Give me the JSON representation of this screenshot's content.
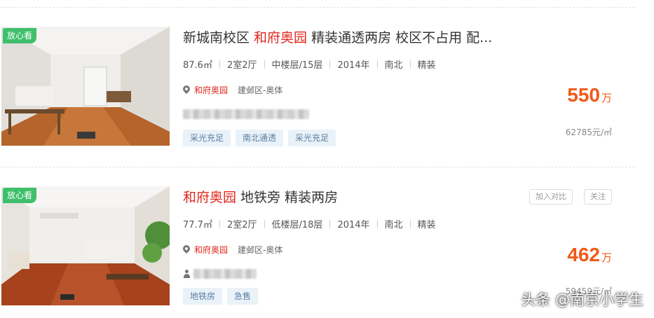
{
  "listings": [
    {
      "badge": "放心看",
      "title_prefix": "新城南校区 ",
      "title_highlight": "和府奥园",
      "title_suffix": " 精装通透两房 校区不占用 配...",
      "facts": {
        "area": "87.6㎡",
        "layout": "2室2厅",
        "floor": "中楼层/15层",
        "year": "2014年",
        "orientation": "南北",
        "decoration": "精装"
      },
      "community": "和府奥园",
      "district": "建邺区-奥体",
      "tags": [
        "采光充足",
        "南北通透",
        "采光充足"
      ],
      "price": "550",
      "price_unit": "万",
      "unit_price": "62785元/㎡"
    },
    {
      "badge": "放心看",
      "title_highlight": "和府奥园",
      "title_suffix": " 地铁旁 精装两房",
      "facts": {
        "area": "77.7㎡",
        "layout": "2室2厅",
        "floor": "低楼层/18层",
        "year": "2014年",
        "orientation": "南北",
        "decoration": "精装"
      },
      "community": "和府奥园",
      "district": "建邺区-奥体",
      "tags": [
        "地铁房",
        "急售"
      ],
      "price": "462",
      "price_unit": "万",
      "unit_price": "59459元/㎡",
      "actions": {
        "compare": "加入对比",
        "follow": "关注"
      }
    }
  ],
  "icons": {
    "location": "map-pin-icon",
    "agent": "person-icon"
  },
  "colors": {
    "accent_red": "#e0281e",
    "price_orange": "#f05a1a",
    "badge_green": "#3fbf6b",
    "tag_bg": "#eaf2f9"
  },
  "watermark": "头条 @南京小学生"
}
